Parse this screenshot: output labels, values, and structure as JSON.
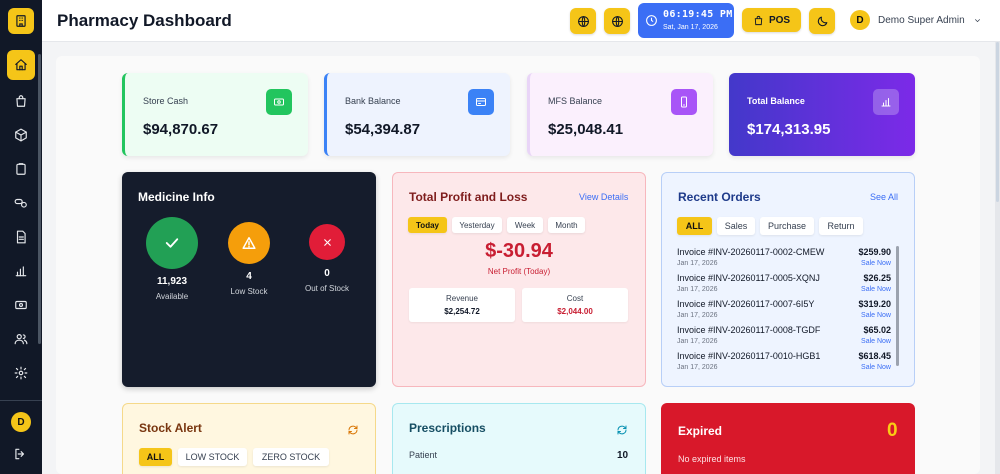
{
  "header": {
    "title": "Pharmacy Dashboard",
    "clock_time": "06:19:45 PM",
    "clock_date": "Sat, Jan 17, 2026",
    "pos_label": "POS",
    "user_initial": "D",
    "user_name": "Demo Super Admin"
  },
  "sidebar": {
    "items": [
      "home-icon",
      "bag-icon",
      "box-icon",
      "clipboard-icon",
      "pills-icon",
      "document-icon",
      "chart-icon",
      "cash-icon",
      "users-icon",
      "gear-icon"
    ],
    "avatar_initial": "D"
  },
  "balances": [
    {
      "label": "Store Cash",
      "value": "$94,870.67",
      "icon": "cash-icon",
      "accent": "#22c55e"
    },
    {
      "label": "Bank Balance",
      "value": "$54,394.87",
      "icon": "card-icon",
      "accent": "#3b82f6"
    },
    {
      "label": "MFS Balance",
      "value": "$25,048.41",
      "icon": "phone-icon",
      "accent": "#a855f7"
    },
    {
      "label": "Total Balance",
      "value": "$174,313.95",
      "icon": "bar-chart-icon",
      "accent": "#6d28d9"
    }
  ],
  "medicine": {
    "title": "Medicine Info",
    "available_count": "11,923",
    "available_label": "Available",
    "low_count": "4",
    "low_label": "Low Stock",
    "out_count": "0",
    "out_label": "Out of Stock"
  },
  "profit": {
    "title": "Total Profit and Loss",
    "view_details": "View Details",
    "tabs": [
      "Today",
      "Yesterday",
      "Week",
      "Month"
    ],
    "active_tab": "Today",
    "net_value": "$-30.94",
    "net_label": "Net Profit (Today)",
    "revenue_label": "Revenue",
    "revenue_value": "$2,254.72",
    "cost_label": "Cost",
    "cost_value": "$2,044.00"
  },
  "orders": {
    "title": "Recent Orders",
    "see_all": "See All",
    "tabs": [
      "ALL",
      "Sales",
      "Purchase",
      "Return"
    ],
    "rows": [
      {
        "invoice": "Invoice #INV-20260117-0002-CMEW",
        "date": "Jan 17, 2026",
        "amount": "$259.90",
        "type": "Sale Now"
      },
      {
        "invoice": "Invoice #INV-20260117-0005-XQNJ",
        "date": "Jan 17, 2026",
        "amount": "$26.25",
        "type": "Sale Now"
      },
      {
        "invoice": "Invoice #INV-20260117-0007-6I5Y",
        "date": "Jan 17, 2026",
        "amount": "$319.20",
        "type": "Sale Now"
      },
      {
        "invoice": "Invoice #INV-20260117-0008-TGDF",
        "date": "Jan 17, 2026",
        "amount": "$65.02",
        "type": "Sale Now"
      },
      {
        "invoice": "Invoice #INV-20260117-0010-HGB1",
        "date": "Jan 17, 2026",
        "amount": "$618.45",
        "type": "Sale Now"
      }
    ]
  },
  "stock_alert": {
    "title": "Stock Alert",
    "tabs": [
      "ALL",
      "LOW STOCK",
      "ZERO STOCK"
    ]
  },
  "prescriptions": {
    "title": "Prescriptions",
    "row_label": "Patient",
    "row_value": "10"
  },
  "expired": {
    "title": "Expired",
    "count": "0",
    "message": "No expired items"
  }
}
